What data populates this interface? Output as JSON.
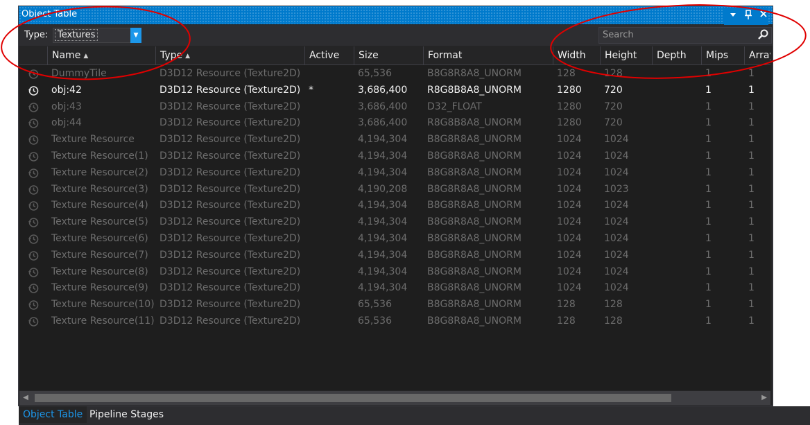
{
  "window": {
    "title": "Object Table",
    "controls": [
      "dropdown-icon",
      "pin-icon",
      "close-icon"
    ]
  },
  "toolbar": {
    "type_label": "Type:",
    "type_value": "Textures",
    "search_placeholder": "Search"
  },
  "columns": [
    {
      "label": "Name",
      "sorted": "ascending"
    },
    {
      "label": "Type",
      "sorted": "ascending"
    },
    {
      "label": "Active"
    },
    {
      "label": "Size"
    },
    {
      "label": "Format"
    },
    {
      "label": "Width"
    },
    {
      "label": "Height"
    },
    {
      "label": "Depth"
    },
    {
      "label": "Mips"
    },
    {
      "label": "Array"
    }
  ],
  "rows": [
    {
      "name": "DummyTile",
      "type": "D3D12 Resource (Texture2D)",
      "active": "",
      "size": "65,536",
      "format": "B8G8R8A8_UNORM",
      "width": "128",
      "height": "128",
      "depth": "",
      "mips": "1",
      "array": "1",
      "dim": true
    },
    {
      "name": "obj:42",
      "type": "D3D12 Resource (Texture2D)",
      "active": "*",
      "size": "3,686,400",
      "format": "R8G8B8A8_UNORM",
      "width": "1280",
      "height": "720",
      "depth": "",
      "mips": "1",
      "array": "1",
      "dim": false
    },
    {
      "name": "obj:43",
      "type": "D3D12 Resource (Texture2D)",
      "active": "",
      "size": "3,686,400",
      "format": "D32_FLOAT",
      "width": "1280",
      "height": "720",
      "depth": "",
      "mips": "1",
      "array": "1",
      "dim": true
    },
    {
      "name": "obj:44",
      "type": "D3D12 Resource (Texture2D)",
      "active": "",
      "size": "3,686,400",
      "format": "R8G8B8A8_UNORM",
      "width": "1280",
      "height": "720",
      "depth": "",
      "mips": "1",
      "array": "1",
      "dim": true
    },
    {
      "name": "Texture Resource",
      "type": "D3D12 Resource (Texture2D)",
      "active": "",
      "size": "4,194,304",
      "format": "B8G8R8A8_UNORM",
      "width": "1024",
      "height": "1024",
      "depth": "",
      "mips": "1",
      "array": "1",
      "dim": true
    },
    {
      "name": "Texture Resource(1)",
      "type": "D3D12 Resource (Texture2D)",
      "active": "",
      "size": "4,194,304",
      "format": "B8G8R8A8_UNORM",
      "width": "1024",
      "height": "1024",
      "depth": "",
      "mips": "1",
      "array": "1",
      "dim": true
    },
    {
      "name": "Texture Resource(2)",
      "type": "D3D12 Resource (Texture2D)",
      "active": "",
      "size": "4,194,304",
      "format": "B8G8R8A8_UNORM",
      "width": "1024",
      "height": "1024",
      "depth": "",
      "mips": "1",
      "array": "1",
      "dim": true
    },
    {
      "name": "Texture Resource(3)",
      "type": "D3D12 Resource (Texture2D)",
      "active": "",
      "size": "4,190,208",
      "format": "B8G8R8A8_UNORM",
      "width": "1024",
      "height": "1023",
      "depth": "",
      "mips": "1",
      "array": "1",
      "dim": true
    },
    {
      "name": "Texture Resource(4)",
      "type": "D3D12 Resource (Texture2D)",
      "active": "",
      "size": "4,194,304",
      "format": "B8G8R8A8_UNORM",
      "width": "1024",
      "height": "1024",
      "depth": "",
      "mips": "1",
      "array": "1",
      "dim": true
    },
    {
      "name": "Texture Resource(5)",
      "type": "D3D12 Resource (Texture2D)",
      "active": "",
      "size": "4,194,304",
      "format": "B8G8R8A8_UNORM",
      "width": "1024",
      "height": "1024",
      "depth": "",
      "mips": "1",
      "array": "1",
      "dim": true
    },
    {
      "name": "Texture Resource(6)",
      "type": "D3D12 Resource (Texture2D)",
      "active": "",
      "size": "4,194,304",
      "format": "B8G8R8A8_UNORM",
      "width": "1024",
      "height": "1024",
      "depth": "",
      "mips": "1",
      "array": "1",
      "dim": true
    },
    {
      "name": "Texture Resource(7)",
      "type": "D3D12 Resource (Texture2D)",
      "active": "",
      "size": "4,194,304",
      "format": "B8G8R8A8_UNORM",
      "width": "1024",
      "height": "1024",
      "depth": "",
      "mips": "1",
      "array": "1",
      "dim": true
    },
    {
      "name": "Texture Resource(8)",
      "type": "D3D12 Resource (Texture2D)",
      "active": "",
      "size": "4,194,304",
      "format": "B8G8R8A8_UNORM",
      "width": "1024",
      "height": "1024",
      "depth": "",
      "mips": "1",
      "array": "1",
      "dim": true
    },
    {
      "name": "Texture Resource(9)",
      "type": "D3D12 Resource (Texture2D)",
      "active": "",
      "size": "4,194,304",
      "format": "B8G8R8A8_UNORM",
      "width": "1024",
      "height": "1024",
      "depth": "",
      "mips": "1",
      "array": "1",
      "dim": true
    },
    {
      "name": "Texture Resource(10)",
      "type": "D3D12 Resource (Texture2D)",
      "active": "",
      "size": "65,536",
      "format": "B8G8R8A8_UNORM",
      "width": "128",
      "height": "128",
      "depth": "",
      "mips": "1",
      "array": "1",
      "dim": true
    },
    {
      "name": "Texture Resource(11)",
      "type": "D3D12 Resource (Texture2D)",
      "active": "",
      "size": "65,536",
      "format": "B8G8R8A8_UNORM",
      "width": "128",
      "height": "128",
      "depth": "",
      "mips": "1",
      "array": "1",
      "dim": true
    }
  ],
  "row_icon": "history-clock-icon",
  "tabs": [
    {
      "label": "Object Table",
      "active": true
    },
    {
      "label": "Pipeline Stages",
      "active": false
    }
  ],
  "colors": {
    "accent": "#007acc",
    "annotation": "#e00000",
    "active_tab_text": "#1c97ea",
    "dim_text": "#6d6d6d"
  }
}
